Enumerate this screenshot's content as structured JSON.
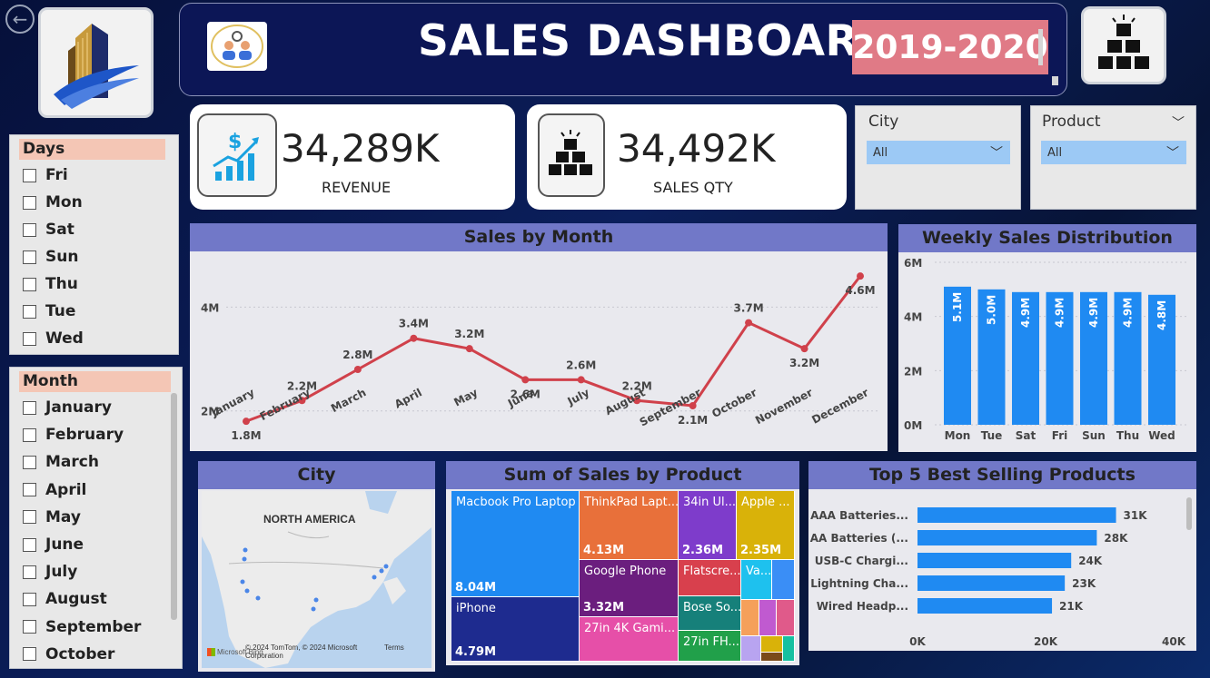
{
  "header": {
    "title": "SALES DASHBOARD",
    "year": "2019-2020"
  },
  "kpis": {
    "revenue": {
      "value": "34,289K",
      "label": "REVENUE"
    },
    "sales_qty": {
      "value": "34,492K",
      "label": "SALES QTY"
    }
  },
  "filters": {
    "city": {
      "title": "City",
      "selected": "All"
    },
    "product": {
      "title": "Product",
      "selected": "All"
    }
  },
  "days_slicer": {
    "title": "Days",
    "items": [
      "Fri",
      "Mon",
      "Sat",
      "Sun",
      "Thu",
      "Tue",
      "Wed"
    ]
  },
  "month_slicer": {
    "title": "Month",
    "items": [
      "January",
      "February",
      "March",
      "April",
      "May",
      "June",
      "July",
      "August",
      "September",
      "October"
    ]
  },
  "panels": {
    "sales_by_month": "Sales by Month",
    "weekly": "Weekly Sales Distribution",
    "city_map": "City",
    "by_product": "Sum of Sales by Product",
    "top5": "Top 5 Best Selling Products"
  },
  "map": {
    "region_label": "NORTH AMERICA",
    "attribution": "© 2024 TomTom, © 2024 Microsoft Corporation",
    "terms": "Terms",
    "brand": "Microsoft Bing"
  },
  "colors": {
    "line": "#d0414b",
    "bar": "#1f8af2",
    "header": "#7178c8",
    "year_bg": "#e07a86"
  },
  "chart_data": [
    {
      "type": "line",
      "title": "Sales by Month",
      "categories": [
        "January",
        "February",
        "March",
        "April",
        "May",
        "June",
        "July",
        "August",
        "September",
        "October",
        "November",
        "December"
      ],
      "values": [
        1.8,
        2.2,
        2.8,
        3.4,
        3.2,
        2.6,
        2.6,
        2.2,
        2.1,
        3.7,
        3.2,
        4.6
      ],
      "data_labels": [
        "1.8M",
        "2.2M",
        "2.8M",
        "3.4M",
        "3.2M",
        "2.6M",
        "2.6M",
        "2.2M",
        "2.1M",
        "3.7M",
        "3.2M",
        "4.6M"
      ],
      "y_ticks": [
        "2M",
        "4M"
      ],
      "ylim": [
        1.4,
        4.9
      ]
    },
    {
      "type": "bar",
      "title": "Weekly Sales Distribution",
      "categories": [
        "Mon",
        "Tue",
        "Sat",
        "Fri",
        "Sun",
        "Thu",
        "Wed"
      ],
      "values": [
        5.1,
        5.0,
        4.9,
        4.9,
        4.9,
        4.9,
        4.8
      ],
      "data_labels": [
        "5.1M",
        "5.0M",
        "4.9M",
        "4.9M",
        "4.9M",
        "4.9M",
        "4.8M"
      ],
      "y_ticks": [
        "0M",
        "2M",
        "4M",
        "6M"
      ],
      "ylim": [
        0,
        6
      ]
    },
    {
      "type": "treemap",
      "title": "Sum of Sales by Product",
      "items": [
        {
          "name": "Macbook Pro Laptop",
          "value": "8.04M",
          "color": "#1f8af2"
        },
        {
          "name": "iPhone",
          "value": "4.79M",
          "color": "#1e2b8f"
        },
        {
          "name": "ThinkPad Lapt...",
          "value": "4.13M",
          "color": "#e8703a"
        },
        {
          "name": "Google Phone",
          "value": "3.32M",
          "color": "#6b1e7e"
        },
        {
          "name": "27in 4K Gami...",
          "value": "",
          "color": "#e64fa8"
        },
        {
          "name": "34in Ul...",
          "value": "2.36M",
          "color": "#7e3ccb"
        },
        {
          "name": "Apple ...",
          "value": "2.35M",
          "color": "#d9b209"
        },
        {
          "name": "Flatscre...",
          "value": "",
          "color": "#d8404d"
        },
        {
          "name": "Bose So...",
          "value": "",
          "color": "#16807a"
        },
        {
          "name": "27in FH...",
          "value": "",
          "color": "#21a04a"
        },
        {
          "name": "Va...",
          "value": "",
          "color": "#1ec1ee"
        }
      ]
    },
    {
      "type": "bar",
      "orientation": "horizontal",
      "title": "Top 5 Best Selling Products",
      "categories": [
        "AAA Batteries...",
        "AA Batteries (...",
        "USB-C Chargi...",
        "Lightning Cha...",
        "Wired Headp..."
      ],
      "values": [
        31,
        28,
        24,
        23,
        21
      ],
      "data_labels": [
        "31K",
        "28K",
        "24K",
        "23K",
        "21K"
      ],
      "x_ticks": [
        "0K",
        "20K",
        "40K"
      ],
      "xlim": [
        0,
        40
      ]
    }
  ]
}
